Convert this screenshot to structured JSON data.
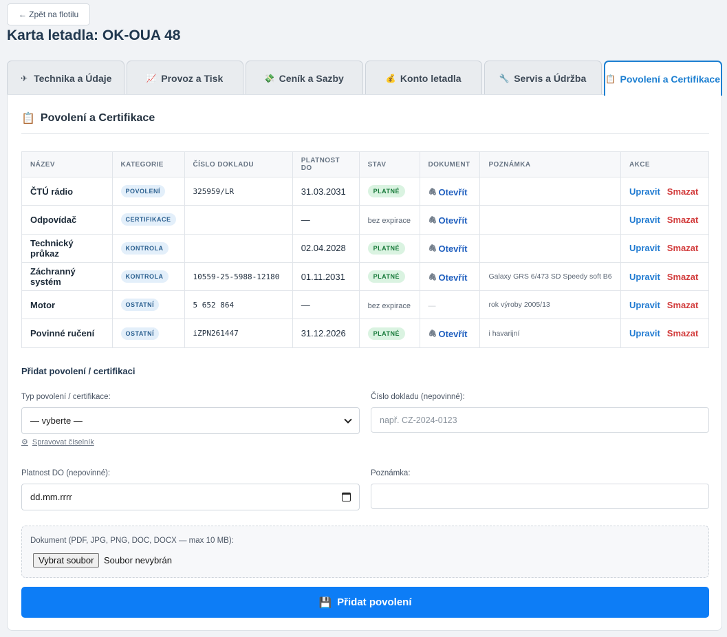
{
  "nav": {
    "back_label": "← Zpět na flotilu"
  },
  "page": {
    "title": "Karta letadla: OK-OUA 48"
  },
  "tabs": [
    {
      "icon": "airplane-icon",
      "glyph": "✈",
      "label": "Technika a Údaje",
      "active": false
    },
    {
      "icon": "chart-icon",
      "glyph": "📈",
      "label": "Provoz a Tisk",
      "active": false
    },
    {
      "icon": "money-icon",
      "glyph": "💸",
      "label": "Ceník a Sazby",
      "active": false
    },
    {
      "icon": "money-bag-icon",
      "glyph": "💰",
      "label": "Konto letadla",
      "active": false
    },
    {
      "icon": "wrench-icon",
      "glyph": "🔧",
      "label": "Servis a Údržba",
      "active": false
    },
    {
      "icon": "clipboard-icon",
      "glyph": "📋",
      "label": "Povolení a Certifikace",
      "active": true
    }
  ],
  "section": {
    "title": "Povolení a Certifikace",
    "icon": "clipboard-icon"
  },
  "table": {
    "headers": [
      "NÁZEV",
      "KATEGORIE",
      "ČÍSLO DOKLADU",
      "PLATNOST DO",
      "STAV",
      "DOKUMENT",
      "POZNÁMKA",
      "AKCE"
    ],
    "rows": [
      {
        "name": "ČTÚ rádio",
        "category": "POVOLENÍ",
        "doc_number": "325959/LR",
        "valid_until": "31.03.2031",
        "state": "PLATNÉ",
        "state_kind": "valid",
        "document": "Otevřít",
        "note": "",
        "edit": "Upravit",
        "delete": "Smazat"
      },
      {
        "name": "Odpovídač",
        "category": "CERTIFIKACE",
        "doc_number": "",
        "valid_until": "—",
        "state": "bez expirace",
        "state_kind": "none",
        "document": "Otevřít",
        "note": "",
        "edit": "Upravit",
        "delete": "Smazat"
      },
      {
        "name": "Technický průkaz",
        "category": "KONTROLA",
        "doc_number": "",
        "valid_until": "02.04.2028",
        "state": "PLATNÉ",
        "state_kind": "valid",
        "document": "Otevřít",
        "note": "",
        "edit": "Upravit",
        "delete": "Smazat"
      },
      {
        "name": "Záchranný systém",
        "category": "KONTROLA",
        "doc_number": "10559-25-5988-12180",
        "valid_until": "01.11.2031",
        "state": "PLATNÉ",
        "state_kind": "valid",
        "document": "Otevřít",
        "note": "Galaxy GRS 6/473 SD Speedy soft B6",
        "edit": "Upravit",
        "delete": "Smazat"
      },
      {
        "name": "Motor",
        "category": "OSTATNÍ",
        "doc_number": "5 652 864",
        "valid_until": "—",
        "state": "bez expirace",
        "state_kind": "none",
        "document": "—",
        "note": "rok výroby 2005/13",
        "edit": "Upravit",
        "delete": "Smazat"
      },
      {
        "name": "Povinné ručení",
        "category": "OSTATNÍ",
        "doc_number": "iZPN261447",
        "valid_until": "31.12.2026",
        "state": "PLATNÉ",
        "state_kind": "valid",
        "document": "Otevřít",
        "note": "i havarijní",
        "edit": "Upravit",
        "delete": "Smazat"
      }
    ]
  },
  "form": {
    "title": "Přidat povolení / certifikaci",
    "type_label": "Typ povolení / certifikace:",
    "type_value": "— vyberte —",
    "manage_link": "Spravovat číselník",
    "docnum_label": "Číslo dokladu (nepovinné):",
    "docnum_placeholder": "např. CZ-2024-0123",
    "valid_label": "Platnost DO (nepovinné):",
    "valid_value": "dd.mm.rrrr",
    "note_label": "Poznámka:",
    "note_value": "",
    "upload_label": "Dokument (PDF, JPG, PNG, DOC, DOCX — max 10 MB):",
    "file_button": "Vybrat soubor",
    "file_status": "Soubor nevybrán",
    "submit_label": "Přidat povolení",
    "submit_icon": "floppy-disk-icon"
  },
  "colors": {
    "accent": "#1c7fd1",
    "primary_button": "#0d7df6",
    "danger": "#d23b3b",
    "valid_badge_bg": "#daf3e1",
    "valid_badge_text": "#187a3a",
    "category_badge_bg": "#e3effa"
  }
}
